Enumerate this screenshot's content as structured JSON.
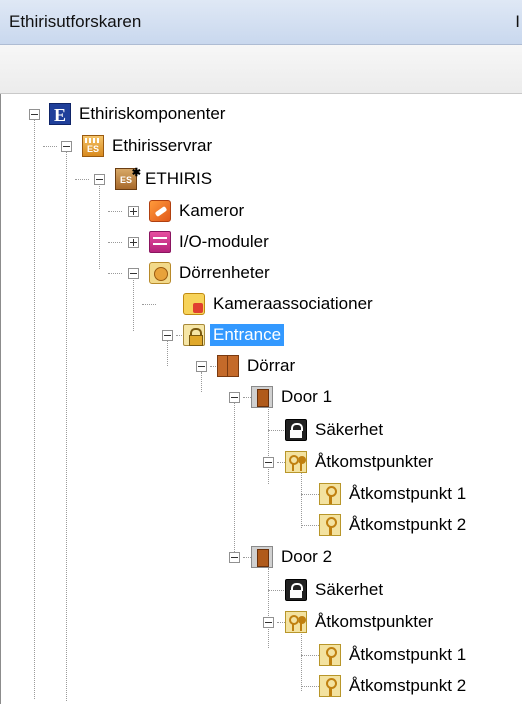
{
  "window": {
    "title": "Ethirisutforskaren",
    "title_right_glyph": "I"
  },
  "tree": {
    "root": "Ethiriskomponenter",
    "servers": "Ethirisservrar",
    "server": "ETHIRIS",
    "cameras": "Kameror",
    "io_modules": "I/O-moduler",
    "door_units": "Dörrenheter",
    "camera_associations": "Kameraassociationer",
    "entrance": "Entrance",
    "doors": "Dörrar",
    "door1": {
      "label": "Door 1",
      "security": "Säkerhet",
      "access_points": "Åtkomstpunkter",
      "ap1": "Åtkomstpunkt 1",
      "ap2": "Åtkomstpunkt 2"
    },
    "door2": {
      "label": "Door 2",
      "security": "Säkerhet",
      "access_points": "Åtkomstpunkter",
      "ap1": "Åtkomstpunkt 1",
      "ap2": "Åtkomstpunkt 2"
    },
    "selected": "entrance"
  },
  "icons": {
    "root": "ethiris-e-icon",
    "servers": "server-group-icon",
    "server": "server-icon",
    "cameras": "camera-icon",
    "io_modules": "io-module-icon",
    "door_units": "door-unit-group-icon",
    "camera_associations": "camera-association-icon",
    "entrance": "door-unit-lock-icon",
    "doors": "doors-icon",
    "door": "door-icon",
    "security": "padlock-icon",
    "access_points": "keys-icon",
    "access_point": "key-icon"
  },
  "colors": {
    "selection": "#3399ff",
    "title_gradient_top": "#dfe8f5"
  }
}
